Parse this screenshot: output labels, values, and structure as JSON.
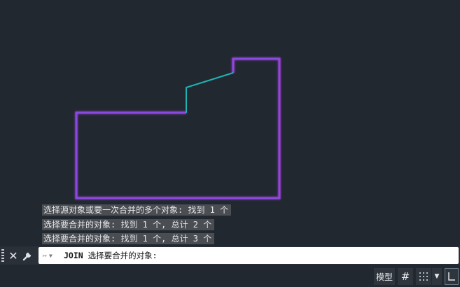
{
  "history": [
    "选择源对象或要一次合并的多个对象: 找到 1 个",
    "选择要合并的对象: 找到 1 个, 总计 2 个",
    "选择要合并的对象: 找到 1 个, 总计 3 个"
  ],
  "command": {
    "name": "JOIN",
    "prompt": "选择要合并的对象:"
  },
  "status": {
    "model_label": "模型"
  },
  "colors": {
    "background": "#212830",
    "selected_outline": "#9b3fd6",
    "line_cyan": "#1fb3b3",
    "history_bg": "#4a4d52"
  },
  "icons": [
    "close-icon",
    "wrench-icon",
    "recent-commands-icon",
    "grid-icon",
    "snap-icon",
    "ucs-icon"
  ]
}
